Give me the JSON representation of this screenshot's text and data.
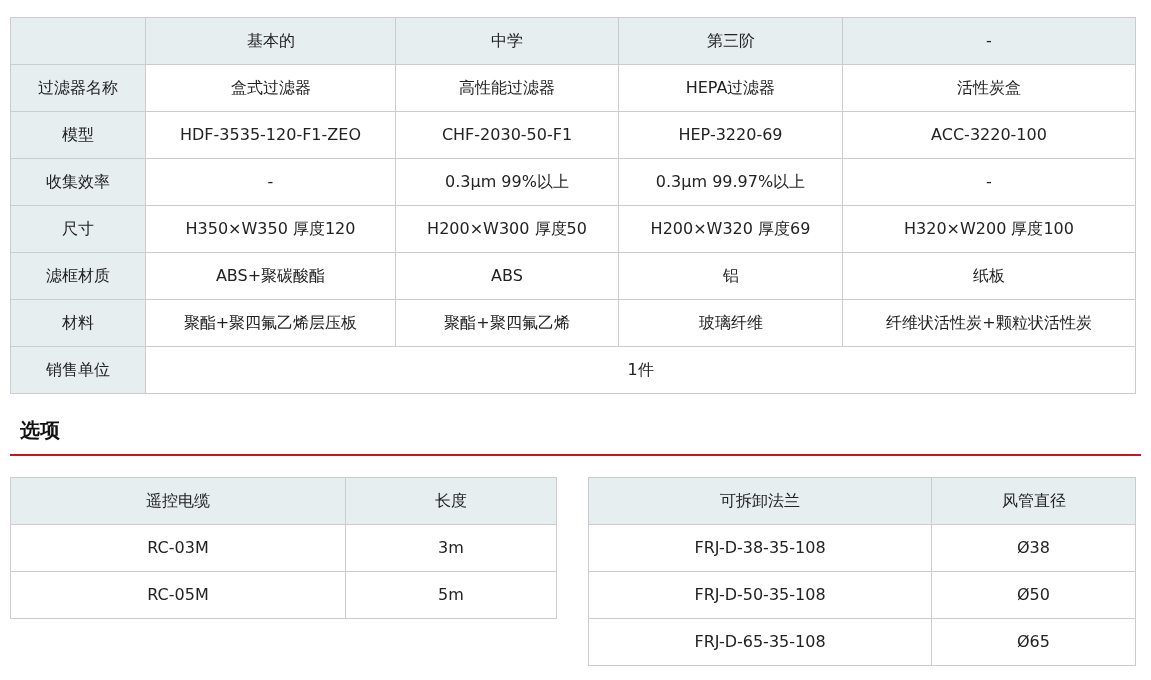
{
  "spec_table": {
    "columns": [
      "基本的",
      "中学",
      "第三阶",
      "-"
    ],
    "rows": [
      {
        "label": "过滤器名称",
        "cells": [
          "盒式过滤器",
          "高性能过滤器",
          "HEPA过滤器",
          "活性炭盒"
        ]
      },
      {
        "label": "模型",
        "cells": [
          "HDF-3535-120-F1-ZEO",
          "CHF-2030-50-F1",
          "HEP-3220-69",
          "ACC-3220-100"
        ]
      },
      {
        "label": "收集效率",
        "cells": [
          "-",
          "0.3μm 99%以上",
          "0.3μm 99.97%以上",
          "-"
        ]
      },
      {
        "label": "尺寸",
        "cells": [
          "H350×W350 厚度120",
          "H200×W300 厚度50",
          "H200×W320 厚度69",
          "H320×W200 厚度100"
        ]
      },
      {
        "label": "滤框材质",
        "cells": [
          "ABS+聚碳酸酯",
          "ABS",
          "铝",
          "纸板"
        ]
      },
      {
        "label": "材料",
        "cells": [
          "聚酯+聚四氟乙烯层压板",
          "聚酯+聚四氟乙烯",
          "玻璃纤维",
          "纤维状活性炭+颗粒状活性炭"
        ]
      },
      {
        "label": "销售单位",
        "cells": [
          {
            "text": "1件",
            "colspan": 4
          }
        ]
      }
    ]
  },
  "options": {
    "title": "选项",
    "tables": [
      {
        "columns": [
          "遥控电缆",
          "长度"
        ],
        "rows": [
          [
            "RC-03M",
            "3m"
          ],
          [
            "RC-05M",
            "5m"
          ]
        ]
      },
      {
        "columns": [
          "可拆卸法兰",
          "风管直径"
        ],
        "rows": [
          [
            "FRJ-D-38-35-108",
            "Ø38"
          ],
          [
            "FRJ-D-50-35-108",
            "Ø50"
          ],
          [
            "FRJ-D-65-35-108",
            "Ø65"
          ]
        ]
      }
    ]
  }
}
